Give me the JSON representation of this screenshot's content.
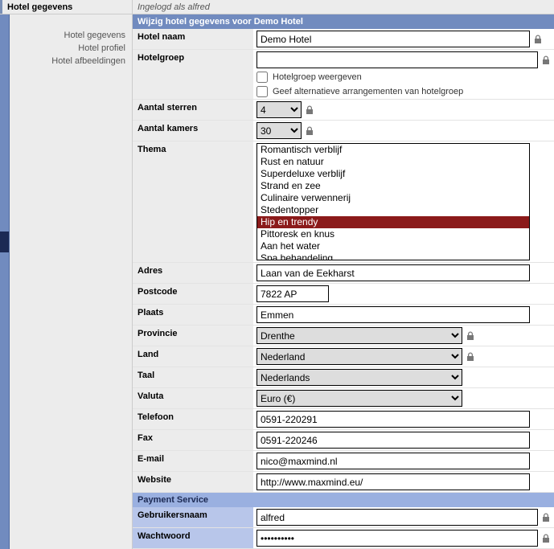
{
  "topbar": {
    "left": "Hotel gegevens",
    "right": "Ingelogd als alfred"
  },
  "sidebar": {
    "items": [
      {
        "label": "Hotel gegevens"
      },
      {
        "label": "Hotel profiel"
      },
      {
        "label": "Hotel afbeeldingen"
      }
    ]
  },
  "section": {
    "title": "Wijzig hotel gegevens voor Demo Hotel",
    "payment_title": "Payment Service"
  },
  "labels": {
    "hotel_naam": "Hotel naam",
    "hotelgroep": "Hotelgroep",
    "sterren": "Aantal sterren",
    "kamers": "Aantal kamers",
    "thema": "Thema",
    "adres": "Adres",
    "postcode": "Postcode",
    "plaats": "Plaats",
    "provincie": "Provincie",
    "land": "Land",
    "taal": "Taal",
    "valuta": "Valuta",
    "telefoon": "Telefoon",
    "fax": "Fax",
    "email": "E-mail",
    "website": "Website",
    "gebruiker": "Gebruikersnaam",
    "wachtwoord": "Wachtwoord",
    "hg_weergeven": "Hotelgroep weergeven",
    "hg_alternatief": "Geef alternatieve arrangementen van hotelgroep"
  },
  "values": {
    "hotel_naam": "Demo Hotel",
    "hotelgroep": "",
    "sterren": "4",
    "kamers": "30",
    "adres": "Laan van de Eekharst",
    "postcode": "7822 AP",
    "plaats": "Emmen",
    "provincie": "Drenthe",
    "land": "Nederland",
    "taal": "Nederlands",
    "valuta": "Euro (€)",
    "telefoon": "0591-220291",
    "fax": "0591-220246",
    "email": "nico@maxmind.nl",
    "website": "http://www.maxmind.eu/",
    "gebruiker": "alfred",
    "wachtwoord": "••••••••••"
  },
  "thema_options": [
    {
      "label": "Romantisch verblijf",
      "sel": false
    },
    {
      "label": "Rust en natuur",
      "sel": false
    },
    {
      "label": "Superdeluxe verblijf",
      "sel": false
    },
    {
      "label": "Strand en zee",
      "sel": false
    },
    {
      "label": "Culinaire verwennerij",
      "sel": false
    },
    {
      "label": "Stedentopper",
      "sel": false
    },
    {
      "label": "Hip en trendy",
      "sel": true
    },
    {
      "label": "Pittoresk en knus",
      "sel": false
    },
    {
      "label": "Aan het water",
      "sel": false
    },
    {
      "label": "Spa behandeling",
      "sel": false
    }
  ]
}
